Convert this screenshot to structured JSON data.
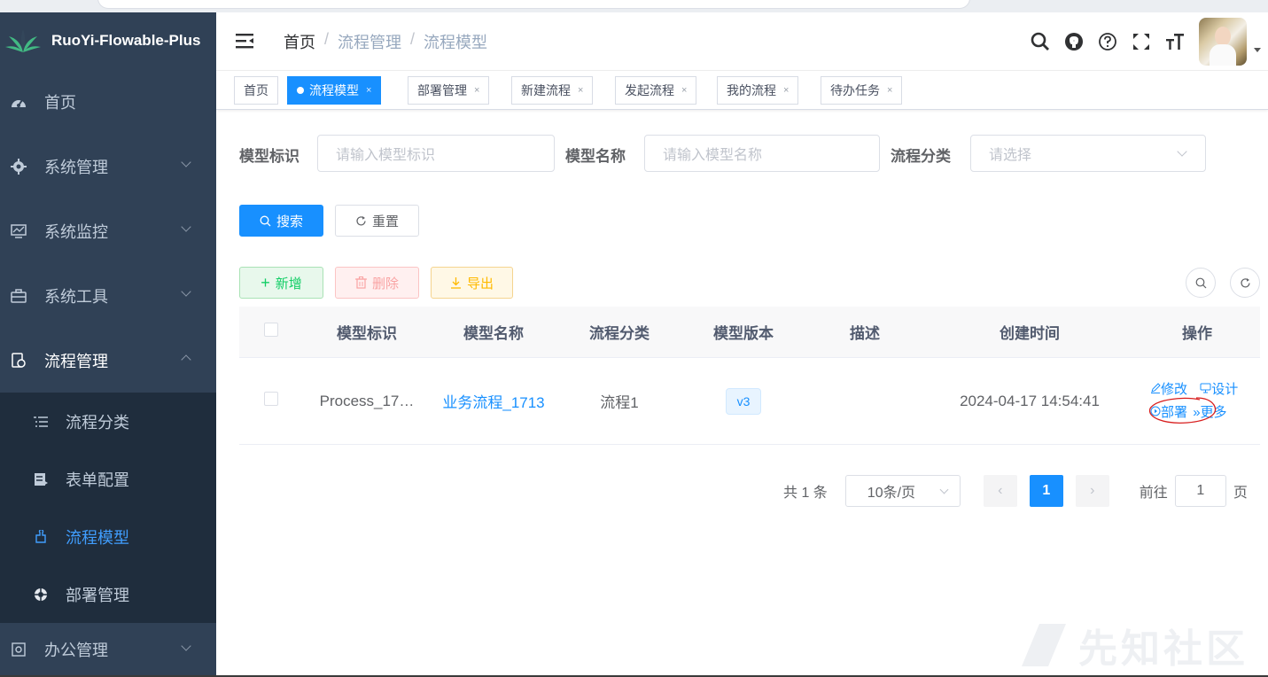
{
  "app": {
    "logo_text": "RuoYi-Flowable-Plus",
    "accent": "#1890ff",
    "sidebar_bg": "#304156"
  },
  "sidebar": {
    "items": [
      {
        "label": "首页",
        "icon": "dashboard-icon"
      },
      {
        "label": "系统管理",
        "icon": "gear-icon"
      },
      {
        "label": "系统监控",
        "icon": "monitor-icon"
      },
      {
        "label": "系统工具",
        "icon": "toolbox-icon"
      },
      {
        "label": "流程管理",
        "icon": "process-icon"
      }
    ],
    "subitems": [
      {
        "label": "流程分类",
        "icon": "list-icon"
      },
      {
        "label": "表单配置",
        "icon": "form-icon"
      },
      {
        "label": "流程模型",
        "icon": "model-icon",
        "active": true
      },
      {
        "label": "部署管理",
        "icon": "deploy-icon"
      }
    ],
    "after": {
      "label": "办公管理",
      "icon": "office-icon"
    }
  },
  "breadcrumb": {
    "items": [
      "首页",
      "流程管理",
      "流程模型"
    ],
    "separator": "/"
  },
  "tags": [
    {
      "label": "首页"
    },
    {
      "label": "流程模型",
      "active": true
    },
    {
      "label": "部署管理"
    },
    {
      "label": "新建流程"
    },
    {
      "label": "发起流程"
    },
    {
      "label": "我的流程"
    },
    {
      "label": "待办任务"
    }
  ],
  "tag_close": "×",
  "filters": {
    "model_key_label": "模型标识",
    "model_key_placeholder": "请输入模型标识",
    "model_name_label": "模型名称",
    "model_name_placeholder": "请输入模型名称",
    "category_label": "流程分类",
    "category_placeholder": "请选择"
  },
  "buttons": {
    "search": "搜索",
    "reset": "重置",
    "add": "新增",
    "delete": "删除",
    "export": "导出"
  },
  "table": {
    "columns": [
      "模型标识",
      "模型名称",
      "流程分类",
      "模型版本",
      "描述",
      "创建时间",
      "操作"
    ],
    "rows": [
      {
        "key": "Process_17…",
        "name": "业务流程_1713",
        "category": "流程1",
        "version": "v3",
        "description": "",
        "created": "2024-04-17 14:54:41",
        "ops": [
          "修改",
          "设计",
          "部署",
          "更多"
        ]
      }
    ]
  },
  "pagination": {
    "total_text": "共 1 条",
    "page_size": "10条/页",
    "current_page": "1",
    "goto_label": "前往",
    "goto_value": "1",
    "page_suffix": "页"
  },
  "watermark": "先知社区"
}
